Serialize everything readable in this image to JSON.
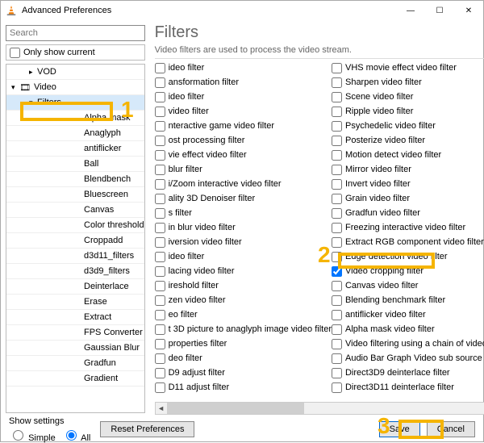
{
  "window": {
    "title": "Advanced Preferences",
    "minimize": "—",
    "maximize": "☐",
    "close": "✕"
  },
  "left": {
    "search_placeholder": "Search",
    "only_show_current": "Only show current",
    "tree": [
      {
        "label": "VOD",
        "level": 2,
        "chev": ">"
      },
      {
        "label": "Video",
        "level": 1,
        "chev": "v",
        "icon": "video"
      },
      {
        "label": "Filters",
        "level": 2,
        "chev": "v",
        "selected": true
      },
      {
        "label": "Alpha mask",
        "level": 4
      },
      {
        "label": "Anaglyph",
        "level": 4
      },
      {
        "label": "antiflicker",
        "level": 4
      },
      {
        "label": "Ball",
        "level": 4
      },
      {
        "label": "Blendbench",
        "level": 4
      },
      {
        "label": "Bluescreen",
        "level": 4
      },
      {
        "label": "Canvas",
        "level": 4
      },
      {
        "label": "Color threshold",
        "level": 4
      },
      {
        "label": "Croppadd",
        "level": 4
      },
      {
        "label": "d3d11_filters",
        "level": 4
      },
      {
        "label": "d3d9_filters",
        "level": 4
      },
      {
        "label": "Deinterlace",
        "level": 4
      },
      {
        "label": "Erase",
        "level": 4
      },
      {
        "label": "Extract",
        "level": 4
      },
      {
        "label": "FPS Converter",
        "level": 4
      },
      {
        "label": "Gaussian Blur",
        "level": 4
      },
      {
        "label": "Gradfun",
        "level": 4
      },
      {
        "label": "Gradient",
        "level": 4
      }
    ]
  },
  "right": {
    "heading": "Filters",
    "desc": "Video filters are used to process the video stream.",
    "col1": [
      "ideo filter",
      "ansformation filter",
      "ideo filter",
      "video filter",
      "nteractive game video filter",
      "ost processing filter",
      "vie effect video filter",
      "blur filter",
      "i/Zoom interactive video filter",
      "ality 3D Denoiser filter",
      "s filter",
      "in blur video filter",
      "iversion video filter",
      "ideo filter",
      "lacing video filter",
      "ireshold filter",
      "zen video filter",
      "eo filter",
      "t 3D picture to anaglyph image video filter",
      "properties filter",
      "deo filter",
      "D9 adjust filter",
      "D11 adjust filter"
    ],
    "col2": [
      {
        "label": "VHS movie effect video filter",
        "checked": false
      },
      {
        "label": "Sharpen video filter",
        "checked": false
      },
      {
        "label": "Scene video filter",
        "checked": false
      },
      {
        "label": "Ripple video filter",
        "checked": false
      },
      {
        "label": "Psychedelic video filter",
        "checked": false
      },
      {
        "label": "Posterize video filter",
        "checked": false
      },
      {
        "label": "Motion detect video filter",
        "checked": false
      },
      {
        "label": "Mirror video filter",
        "checked": false
      },
      {
        "label": "Invert video filter",
        "checked": false
      },
      {
        "label": "Grain video filter",
        "checked": false
      },
      {
        "label": "Gradfun video filter",
        "checked": false
      },
      {
        "label": "Freezing interactive video filter",
        "checked": false
      },
      {
        "label": "Extract RGB component video filter",
        "checked": false
      },
      {
        "label": "Edge detection video filter",
        "checked": false
      },
      {
        "label": "Video cropping filter",
        "checked": true
      },
      {
        "label": "Canvas video filter",
        "checked": false
      },
      {
        "label": "Blending benchmark filter",
        "checked": false
      },
      {
        "label": "antiflicker video filter",
        "checked": false
      },
      {
        "label": "Alpha mask video filter",
        "checked": false
      },
      {
        "label": "Video filtering using a chain of video filt",
        "checked": false
      },
      {
        "label": "Audio Bar Graph Video sub source",
        "checked": false
      },
      {
        "label": "Direct3D9 deinterlace filter",
        "checked": false
      },
      {
        "label": "Direct3D11 deinterlace filter",
        "checked": false
      }
    ]
  },
  "bottom": {
    "show_settings": "Show settings",
    "simple": "Simple",
    "all": "All",
    "reset": "Reset Preferences",
    "save": "Save",
    "cancel": "Cancel"
  },
  "annotations": {
    "n1": "1",
    "n2": "2",
    "n3": "3"
  }
}
